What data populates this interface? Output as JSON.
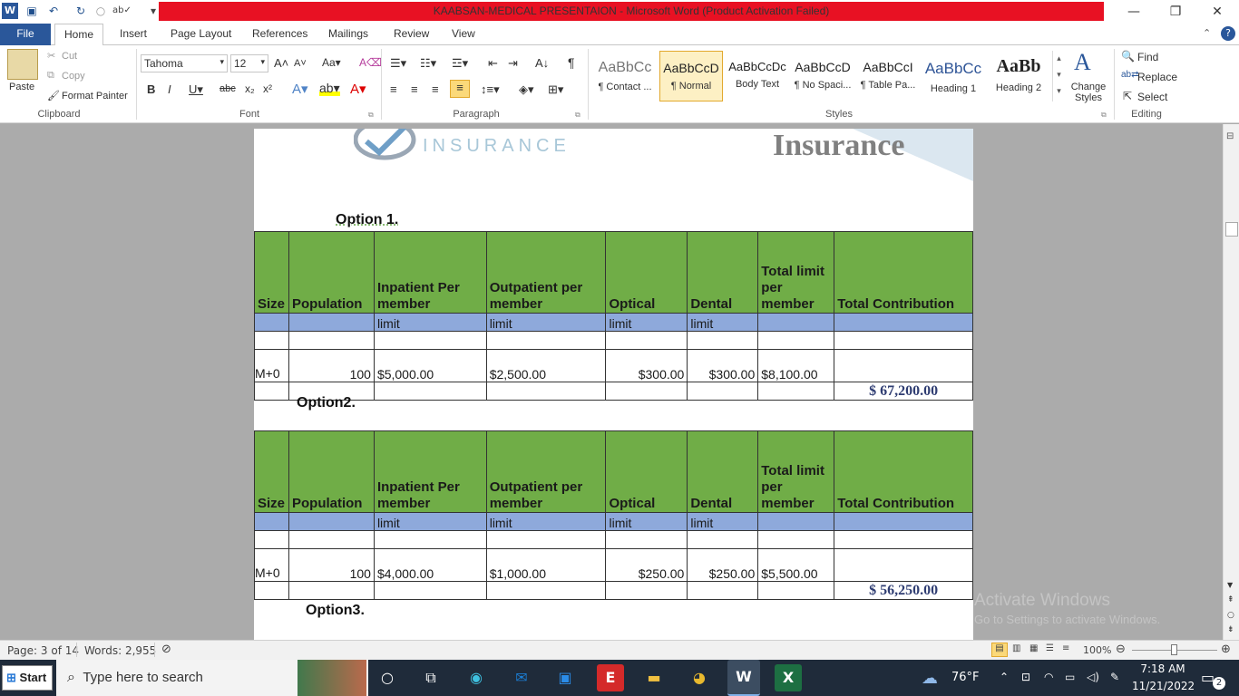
{
  "window": {
    "title": "KAABSAN-MEDICAL PRESENTAION  -  Microsoft Word (Product Activation Failed)",
    "controls": {
      "minimize": "—",
      "restore": "❐",
      "close": "✕"
    }
  },
  "tabs": [
    "File",
    "Home",
    "Insert",
    "Page Layout",
    "References",
    "Mailings",
    "Review",
    "View"
  ],
  "ribbon": {
    "clipboard": {
      "paste": "Paste",
      "cut": "Cut",
      "copy": "Copy",
      "format_painter": "Format Painter",
      "label": "Clipboard"
    },
    "font": {
      "name": "Tahoma",
      "size": "12",
      "label": "Font"
    },
    "paragraph": {
      "label": "Paragraph"
    },
    "styles": {
      "label": "Styles",
      "items": [
        {
          "sample": "AaBbCc",
          "name": "¶ Contact ..."
        },
        {
          "sample": "AaBbCcD",
          "name": "¶ Normal"
        },
        {
          "sample": "AaBbCcDc",
          "name": "Body Text"
        },
        {
          "sample": "AaBbCcD",
          "name": "¶ No Spaci..."
        },
        {
          "sample": "AaBbCcI",
          "name": "¶ Table Pa..."
        },
        {
          "sample": "AaBbCc",
          "name": "Heading 1"
        },
        {
          "sample": "AaBb",
          "name": "Heading 2"
        }
      ],
      "change_styles": "Change Styles"
    },
    "editing": {
      "find": "Find",
      "replace": "Replace",
      "select": "Select",
      "label": "Editing"
    }
  },
  "document": {
    "logo_text": "INSURANCE",
    "header_word": "Insurance",
    "headers": [
      "Size",
      "Population",
      "Inpatient Per member",
      "Outpatient per member",
      "Optical",
      "Dental",
      "Total limit per member",
      "Total Contribution"
    ],
    "subheaders": [
      "",
      "",
      "limit",
      "limit",
      "limit",
      "limit",
      "",
      ""
    ],
    "options": [
      {
        "title": "Option 1.",
        "row": [
          "M+0",
          "100",
          "$5,000.00",
          "$2,500.00",
          "$300.00",
          "$300.00",
          "$8,100.00",
          ""
        ],
        "total": "$  67,200.00"
      },
      {
        "title": "Option2.",
        "row": [
          "M+0",
          "100",
          "$4,000.00",
          "$1,000.00",
          "$250.00",
          "$250.00",
          "$5,500.00",
          ""
        ],
        "total": "$  56,250.00"
      }
    ],
    "option3_title": "Option3."
  },
  "watermark": {
    "line1": "Activate Windows",
    "line2": "Go to Settings to activate Windows."
  },
  "status": {
    "page": "Page: 3 of 14",
    "words": "Words: 2,955",
    "zoom": "100%"
  },
  "taskbar": {
    "start": "Start",
    "search_placeholder": "Type here to search",
    "weather": "76°F",
    "time": "7:18 AM",
    "date": "11/21/2022",
    "notifications": "2"
  }
}
